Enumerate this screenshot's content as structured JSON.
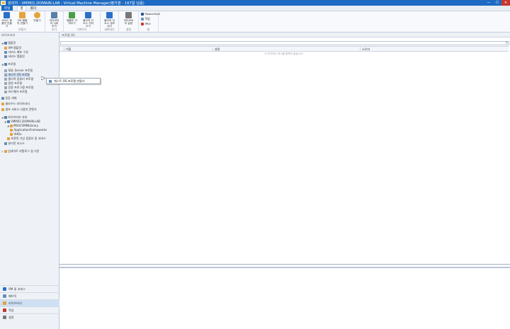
{
  "window": {
    "title": "관리자 - VMM01.DOMAIN.LAB - Virtual Machine Manager(평가판 - 167일 남음)",
    "minimize": "—",
    "maximize": "☐",
    "close": "✕"
  },
  "menubar": {
    "file": "파일",
    "tabs": [
      "홈",
      "폴더"
    ]
  },
  "ribbon": {
    "groups": [
      {
        "label": "만들기",
        "buttons": [
          "서비스 템플릿 만들기",
          "VM 템플릿 만들기",
          "만들기"
        ]
      },
      {
        "label": "추가",
        "buttons": [
          "라이브러리 서버 추가"
        ]
      },
      {
        "label": "가져오기",
        "buttons": [
          "템플릿 가져오기",
          "물리적 리소스 가져오기"
        ]
      },
      {
        "label": "내보내기",
        "buttons": [
          "물리적 리소스 내보내기"
        ]
      },
      {
        "label": "설정",
        "buttons": [
          "라이브러리 설정"
        ]
      },
      {
        "label": "창",
        "small": [
          "PowerShell",
          "작업",
          "PRO"
        ]
      }
    ],
    "colors": {
      "blue": "#2a6fc9",
      "orange": "#e5a33b",
      "green": "#4a9e4a"
    }
  },
  "leftpane": {
    "header": "라이브러리",
    "tree": [
      {
        "label": "템플릿",
        "level": 0,
        "arrow": "◢"
      },
      {
        "label": "VM 템플릿",
        "level": 1
      },
      {
        "label": "서비스 배포 구성",
        "level": 1
      },
      {
        "label": "서비스 템플릿",
        "level": 1
      },
      {
        "label": "프로필",
        "level": 0,
        "arrow": "◢"
      },
      {
        "label": "SQL Server 프로필",
        "level": 1
      },
      {
        "label": "게스트 OS 프로필",
        "level": 1,
        "selected": true
      },
      {
        "label": "물리적 컴퓨터 프로필",
        "level": 1
      },
      {
        "label": "용량 프로필",
        "level": 1
      },
      {
        "label": "응용 프로그램 프로필",
        "level": 1
      },
      {
        "label": "하드웨어 프로필",
        "level": 1
      },
      {
        "label": "동등 개체",
        "level": 0
      },
      {
        "label": "클라우드 라이브러리",
        "level": 0
      },
      {
        "label": "셀프 서비스 사용자 콘텐츠",
        "level": 0
      },
      {
        "label": "라이브러리 서버",
        "level": 0,
        "arrow": "◢"
      },
      {
        "label": "VMM01.DOMAIN.LAB",
        "level": 1,
        "arrow": "◢"
      },
      {
        "label": "MSSCVMMLibrary",
        "level": 2,
        "arrow": "◢"
      },
      {
        "label": "ApplicationFrameworks",
        "level": 3
      },
      {
        "label": "VHDs",
        "level": 3
      },
      {
        "label": "보관된 가상 컴퓨터 및 서비스",
        "level": 2
      },
      {
        "label": "분리된 리소스",
        "level": 1
      },
      {
        "label": "업데이트 카탈로그 및 기준",
        "level": 0,
        "arrow": "▷"
      }
    ],
    "workspaces": [
      {
        "label": "VM 및 서비스"
      },
      {
        "label": "패브릭"
      },
      {
        "label": "라이브러리",
        "selected": true
      },
      {
        "label": "작업"
      },
      {
        "label": "설정"
      }
    ]
  },
  "main": {
    "title": "프로필 (0)",
    "search_placeholder": "",
    "columns": [
      "이름",
      "설명",
      "소유자"
    ],
    "empty_message": "이 보기에서 표시할 항목이 없습니다."
  },
  "context_menu": {
    "items": [
      "게스트 OS 프로필 만들기"
    ]
  }
}
